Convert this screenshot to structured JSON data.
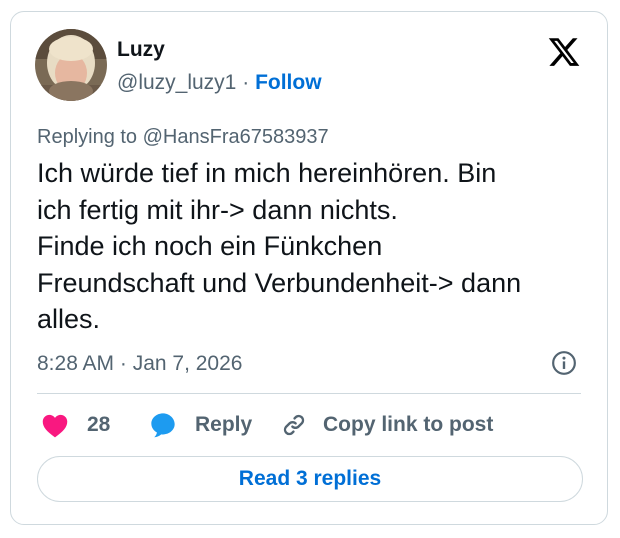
{
  "author": {
    "name": "Luzy",
    "handle": "@luzy_luzy1",
    "separator": "·",
    "follow_label": "Follow"
  },
  "platform_icon": "x-logo-icon",
  "replying": {
    "prefix": "Replying to",
    "mention": "@HansFra67583937"
  },
  "post": {
    "lines": [
      "Ich würde tief in mich hereinhören. Bin",
      "ich fertig mit ihr-> dann nichts.",
      "Finde ich noch ein Fünkchen",
      "Freundschaft und Verbundenheit-> dann",
      "alles."
    ],
    "timestamp": "8:28 AM · Jan 7, 2026",
    "info_icon": "info-icon"
  },
  "actions": {
    "like": {
      "icon": "heart-icon",
      "count": "28"
    },
    "reply": {
      "icon": "speech-bubble-icon",
      "label": "Reply"
    },
    "copy": {
      "icon": "link-icon",
      "label": "Copy link to post"
    }
  },
  "read_replies_label": "Read 3 replies",
  "colors": {
    "text": "#0f1419",
    "secondary": "#536471",
    "link": "#006fd6",
    "heart": "#f91880",
    "reply_bubble": "#1d9bf0",
    "border": "#cfd9de"
  }
}
